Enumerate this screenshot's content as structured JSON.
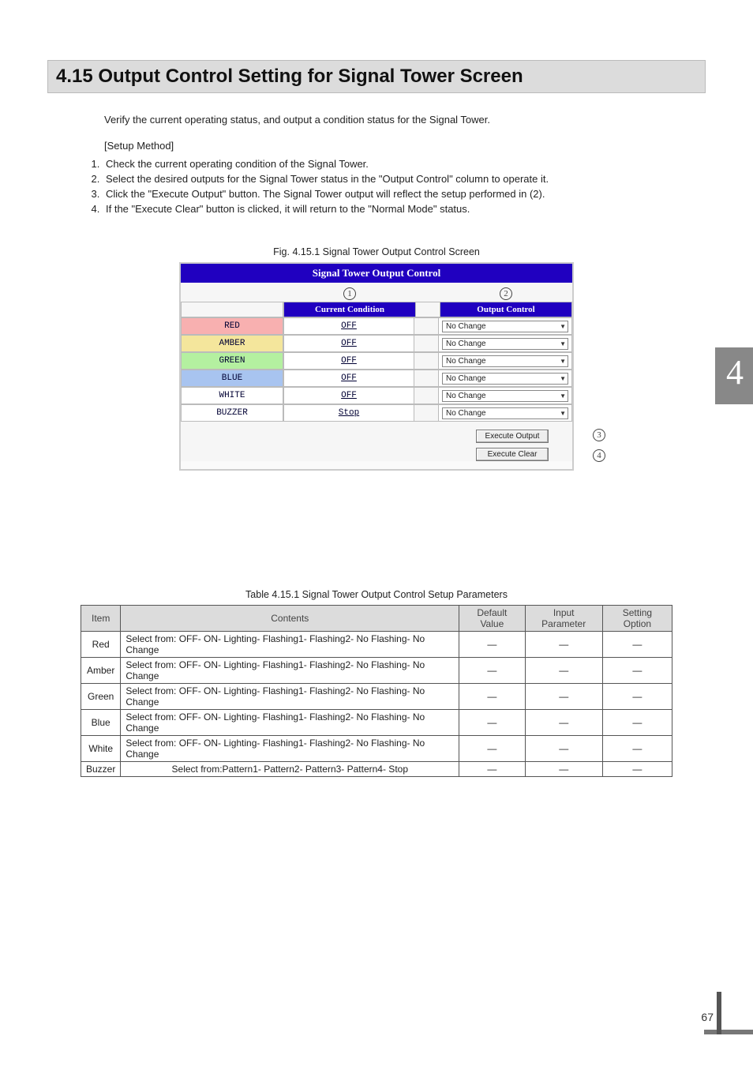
{
  "section": {
    "number": "4.15",
    "title": "Output Control Setting for Signal Tower Screen"
  },
  "intro": "Verify the current operating status, and output a condition status for the Signal Tower.",
  "setup_label": "[Setup Method]",
  "steps": [
    "Check the current operating condition of the Signal Tower.",
    "Select the desired outputs for the Signal Tower status in the \"Output Control\" column to operate it.",
    "Click the \"Execute Output\" button.  The Signal Tower output will reflect the setup performed in (2).",
    "If the \"Execute Clear\" button is clicked, it will return to the \"Normal Mode\" status."
  ],
  "figure": {
    "caption": "Fig. 4.15.1 Signal Tower Output Control Screen",
    "panel_title": "Signal Tower Output Control",
    "callout_1": "1",
    "callout_2": "2",
    "callout_3": "3",
    "callout_4": "4",
    "head_condition": "Current Condition",
    "head_control": "Output Control",
    "rows": [
      {
        "label": "RED",
        "cond": "OFF",
        "ctrl": "No Change",
        "cls": "lbl-red"
      },
      {
        "label": "AMBER",
        "cond": "OFF",
        "ctrl": "No Change",
        "cls": "lbl-amber"
      },
      {
        "label": "GREEN",
        "cond": "OFF",
        "ctrl": "No Change",
        "cls": "lbl-green"
      },
      {
        "label": "BLUE",
        "cond": "OFF",
        "ctrl": "No Change",
        "cls": "lbl-blue"
      },
      {
        "label": "WHITE",
        "cond": "OFF",
        "ctrl": "No Change",
        "cls": "lbl-white"
      },
      {
        "label": "BUZZER",
        "cond": "Stop",
        "ctrl": "No Change",
        "cls": "lbl-buzz"
      }
    ],
    "btn_exec_output": "Execute Output",
    "btn_exec_clear": "Execute Clear"
  },
  "table": {
    "caption": "Table 4.15.1 Signal Tower Output Control Setup Parameters",
    "headers": {
      "item": "Item",
      "contents": "Contents",
      "default": "Default Value",
      "input": "Input Parameter",
      "option": "Setting Option"
    },
    "dash": "—",
    "rows": [
      {
        "item": "Red",
        "contents": "Select from: OFF- ON- Lighting- Flashing1- Flashing2- No Flashing- No Change"
      },
      {
        "item": "Amber",
        "contents": "Select from: OFF- ON- Lighting- Flashing1- Flashing2- No Flashing- No Change"
      },
      {
        "item": "Green",
        "contents": "Select from: OFF- ON- Lighting- Flashing1- Flashing2- No Flashing- No Change"
      },
      {
        "item": "Blue",
        "contents": "Select from: OFF- ON- Lighting- Flashing1- Flashing2- No Flashing- No Change"
      },
      {
        "item": "White",
        "contents": "Select from: OFF- ON- Lighting- Flashing1- Flashing2- No Flashing- No Change"
      },
      {
        "item": "Buzzer",
        "contents": "Select from:Pattern1- Pattern2- Pattern3- Pattern4- Stop"
      }
    ]
  },
  "chapter_tab": "4",
  "page_number": "67"
}
